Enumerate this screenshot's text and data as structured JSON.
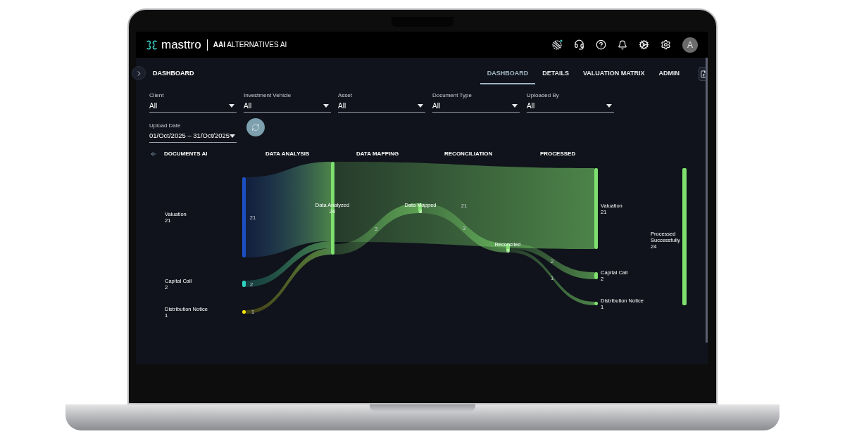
{
  "header": {
    "brand": "masttro",
    "product": "**AAI** ALTERNATIVES AI",
    "avatar": "A"
  },
  "subheader": {
    "title": "DASHBOARD",
    "tabs": [
      {
        "label": "DASHBOARD",
        "selected": true
      },
      {
        "label": "DETAILS",
        "selected": false
      },
      {
        "label": "VALUATION MATRIX",
        "selected": false
      },
      {
        "label": "ADMIN",
        "selected": false
      }
    ]
  },
  "filters": [
    {
      "label": "Client",
      "value": "All"
    },
    {
      "label": "Investment Vehicle",
      "value": "All"
    },
    {
      "label": "Asset",
      "value": "All"
    },
    {
      "label": "Document Type",
      "value": "All"
    },
    {
      "label": "Uploaded By",
      "value": "All"
    },
    {
      "label": "Upload Date",
      "value": "01/Oct/2025 – 31/Oct/2025"
    }
  ],
  "stages": [
    "DOCUMENTS AI",
    "DATA ANALYSIS",
    "DATA MAPPING",
    "RECONCILIATION",
    "PROCESSED"
  ],
  "sankey": {
    "nodes": [
      {
        "label": "Valuation",
        "count": "21",
        "color": "#1d4fc4"
      },
      {
        "label": "Capital Call",
        "count": "2",
        "color": "#2dd4bf"
      },
      {
        "label": "Distribution Notice",
        "count": "1",
        "color": "#f5e50a"
      },
      {
        "label": "Data Analyzed",
        "count": "24",
        "color": "#7ee06e"
      },
      {
        "label": "Data Mapped",
        "count": "3",
        "color": "#7ee06e"
      },
      {
        "label": "Reconciled",
        "count": "3",
        "color": "#7ee06e"
      },
      {
        "label": "Valuation",
        "count": "21",
        "color": "#7ee06e"
      },
      {
        "label": "Capital Call",
        "count": "2",
        "color": "#7ee06e"
      },
      {
        "label": "Distribution Notice",
        "count": "1",
        "color": "#7ee06e"
      },
      {
        "label": "Processed Successfully",
        "count": "24",
        "color": "#7ee06e"
      }
    ],
    "links": [
      {
        "value": "21"
      },
      {
        "value": "2"
      },
      {
        "value": "1"
      },
      {
        "value": "21"
      },
      {
        "value": "3"
      },
      {
        "value": "3"
      },
      {
        "value": "2"
      },
      {
        "value": "1"
      }
    ]
  }
}
